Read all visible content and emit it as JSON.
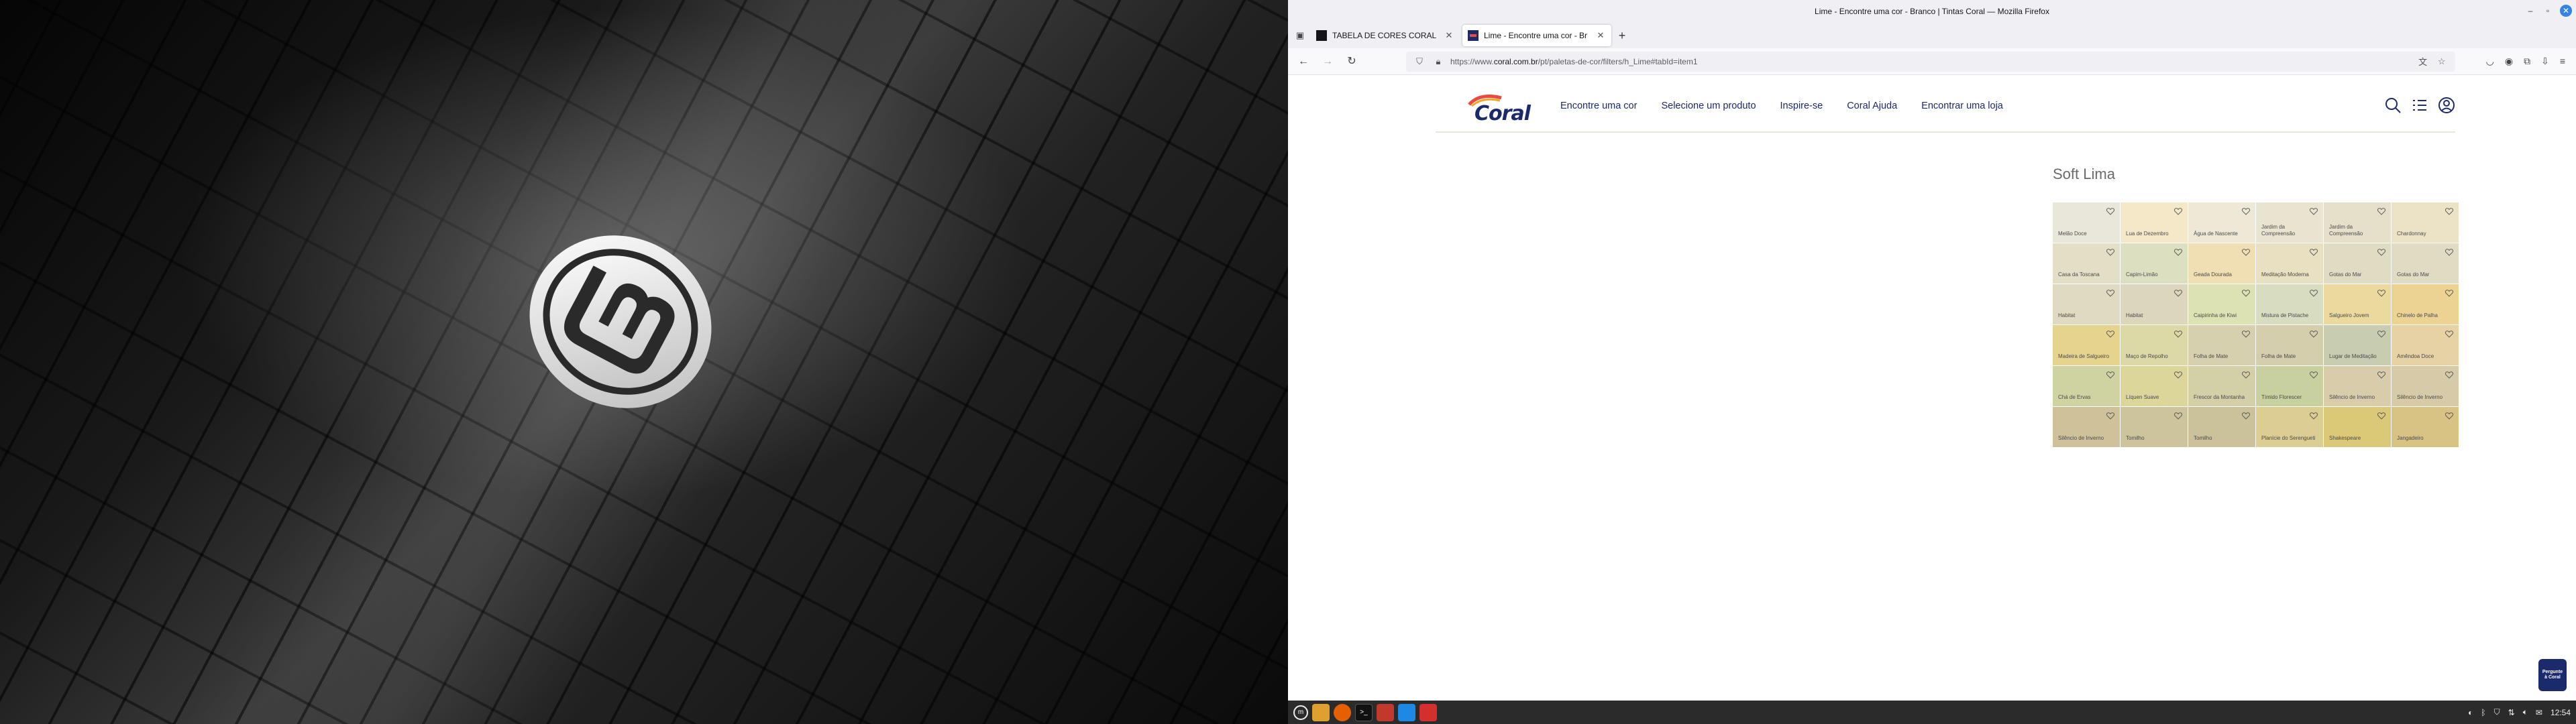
{
  "window": {
    "title": "Lime - Encontre uma cor - Branco | Tintas Coral — Mozilla Firefox"
  },
  "tabs": [
    {
      "label": "TABELA DE CORES CORAL -",
      "active": false
    },
    {
      "label": "Lime - Encontre uma cor - Br",
      "active": true
    }
  ],
  "urlbar": {
    "prefix": "https://www.",
    "domain": "coral.com.br",
    "path": "/pt/paletas-de-cor/filters/h_Lime#tabId=item1"
  },
  "site": {
    "logo_text": "Coral",
    "nav": [
      "Encontre uma cor",
      "Selecione um produto",
      "Inspire-se",
      "Coral Ajuda",
      "Encontrar uma loja"
    ],
    "section_title": "Soft Lima",
    "help_badge": "Pergunte à Coral"
  },
  "swatches": [
    {
      "name": "Melão Doce",
      "color": "#e8e7da"
    },
    {
      "name": "Lua de Dezembro",
      "color": "#f5e8c8"
    },
    {
      "name": "Água de Nascente",
      "color": "#eee8d6"
    },
    {
      "name": "Jardim da Compreensão",
      "color": "#e9e4cf"
    },
    {
      "name": "Jardim da Compreensão",
      "color": "#e6e0ca"
    },
    {
      "name": "Chardonnay",
      "color": "#ece3c6"
    },
    {
      "name": "Casa da Toscana",
      "color": "#e3dfc6"
    },
    {
      "name": "Capim-Limão",
      "color": "#dce0c0"
    },
    {
      "name": "Geada Dourada",
      "color": "#f0dfb3"
    },
    {
      "name": "Meditação Moderna",
      "color": "#e8e0c0"
    },
    {
      "name": "Gotas do Mar",
      "color": "#e0dcc4"
    },
    {
      "name": "Gotas do Mar",
      "color": "#e0dcc4"
    },
    {
      "name": "Habitat",
      "color": "#dfdac0"
    },
    {
      "name": "Habitat",
      "color": "#dcd6bd"
    },
    {
      "name": "Caipirinha de Kiwi",
      "color": "#dde2b4"
    },
    {
      "name": "Mistura de Pistache",
      "color": "#d8dcc0"
    },
    {
      "name": "Salgueiro Jovem",
      "color": "#ecd99e"
    },
    {
      "name": "Chinelo de Palha",
      "color": "#ecd394"
    },
    {
      "name": "Madeira de Salgueiro",
      "color": "#e6d48e"
    },
    {
      "name": "Maço de Repolho",
      "color": "#dcd9a6"
    },
    {
      "name": "Folha de Mate",
      "color": "#d6d0ae"
    },
    {
      "name": "Folha de Mate",
      "color": "#d4ceac"
    },
    {
      "name": "Lugar de Meditação",
      "color": "#c8ccb1"
    },
    {
      "name": "Amêndoa Doce",
      "color": "#e6d2a4"
    },
    {
      "name": "Chá de Ervas",
      "color": "#cfd3a2"
    },
    {
      "name": "Líquen Suave",
      "color": "#dcd69b"
    },
    {
      "name": "Frescor da Montanha",
      "color": "#d3d0a8"
    },
    {
      "name": "Tímido Florescer",
      "color": "#c9d0a0"
    },
    {
      "name": "Silêncio de Inverno",
      "color": "#d8ccaa"
    },
    {
      "name": "Silêncio de Inverno",
      "color": "#d6caa8"
    },
    {
      "name": "Silêncio de Inverno",
      "color": "#cfc29a"
    },
    {
      "name": "Tomilho",
      "color": "#cdc39c"
    },
    {
      "name": "Tomilho",
      "color": "#cbc19a"
    },
    {
      "name": "Planície do Serengueti",
      "color": "#dccd92"
    },
    {
      "name": "Shakespeare",
      "color": "#dcc978"
    },
    {
      "name": "Jangadeiro",
      "color": "#d8c384"
    }
  ],
  "taskbar": {
    "clock": "12:54"
  },
  "icons": {
    "menu": "mint-menu-icon",
    "files": "folder-icon",
    "firefox": "firefox-icon",
    "terminal": "terminal-icon",
    "calc": "spreadsheet-icon",
    "vscode": "vscode-icon",
    "pdf": "pdf-icon"
  }
}
